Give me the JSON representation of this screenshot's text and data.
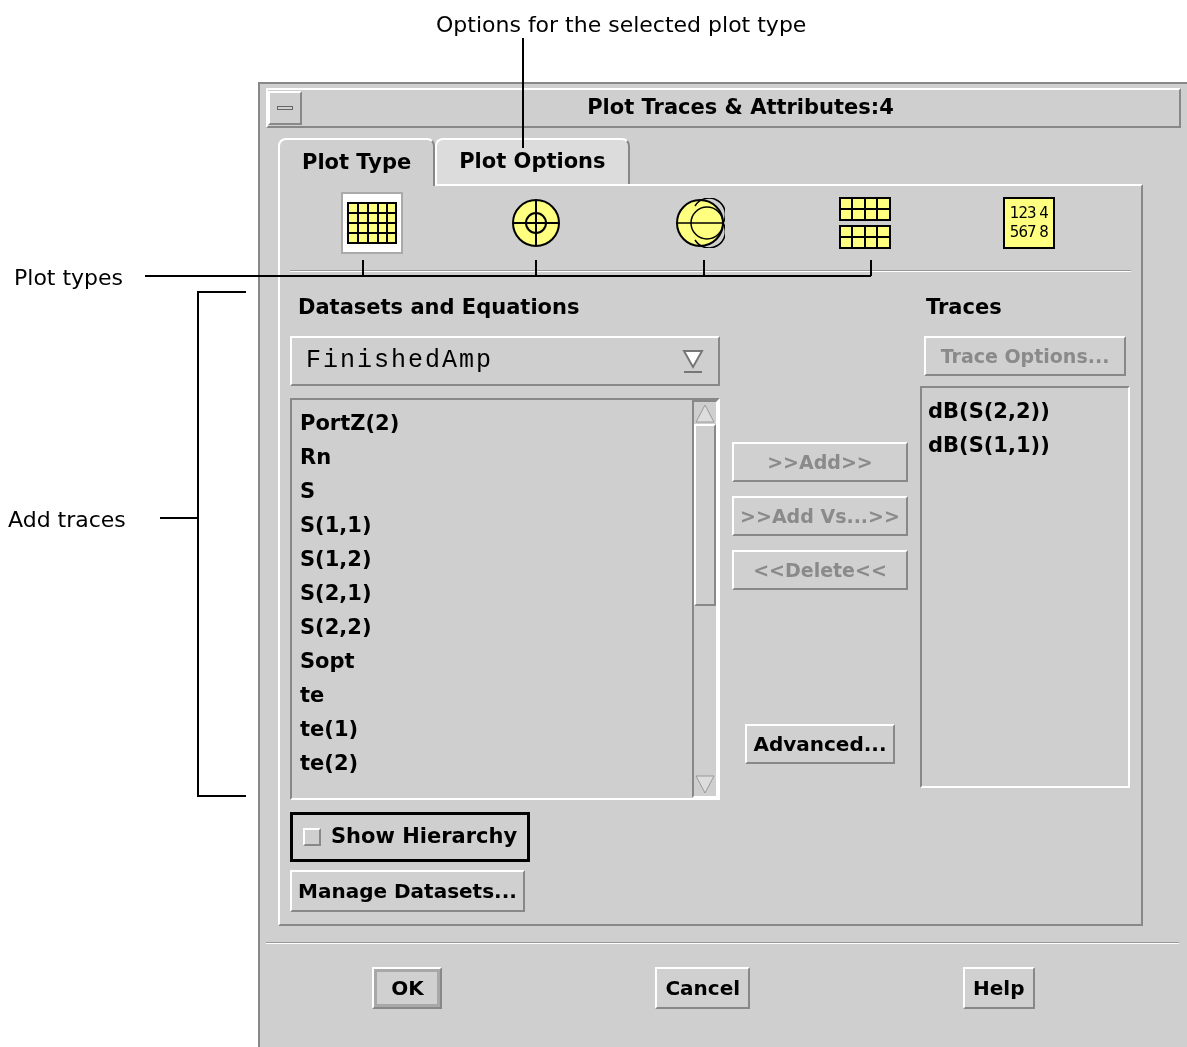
{
  "annotations": [
    {
      "kind": "top",
      "text": "Options for the selected plot type"
    },
    {
      "kind": "plot-types",
      "text": "Plot types"
    },
    {
      "kind": "bracket",
      "text": "Add traces"
    }
  ],
  "window": {
    "title": "Plot Traces & Attributes:4"
  },
  "tabs": [
    {
      "label": "Plot Type",
      "selected": true
    },
    {
      "label": "Plot Options",
      "selected": false
    }
  ],
  "plot_types": [
    {
      "kind": "rectangular",
      "selected": true
    },
    {
      "kind": "polar",
      "selected": false
    },
    {
      "kind": "smith",
      "selected": false
    },
    {
      "kind": "stacked",
      "selected": false
    },
    {
      "kind": "list",
      "selected": false,
      "label_lines": [
        "123 4",
        "567 8"
      ]
    }
  ],
  "datasets": {
    "heading": "Datasets and Equations",
    "dropdown": "FinishedAmp",
    "items": [
      "PortZ(2)",
      "Rn",
      "S",
      "S(1,1)",
      "S(1,2)",
      "S(2,1)",
      "S(2,2)",
      "Sopt",
      "te",
      "te(1)",
      "te(2)"
    ]
  },
  "actions": [
    {
      "label": ">>Add>>",
      "disabled": true
    },
    {
      "label": ">>Add Vs...>>",
      "disabled": true
    },
    {
      "label": "<<Delete<<",
      "disabled": true
    }
  ],
  "advanced": {
    "label": "Advanced...",
    "disabled": false
  },
  "traces": {
    "heading": "Traces",
    "options_button": {
      "label": "Trace Options...",
      "disabled": true
    },
    "items": [
      "dB(S(2,2))",
      "dB(S(1,1))"
    ]
  },
  "show_hierarchy": {
    "label": "Show Hierarchy",
    "checked": false
  },
  "manage_button": "Manage Datasets...",
  "footer_buttons": [
    {
      "label": "OK",
      "default": true
    },
    {
      "label": "Cancel",
      "default": false
    },
    {
      "label": "Help",
      "default": false
    }
  ]
}
